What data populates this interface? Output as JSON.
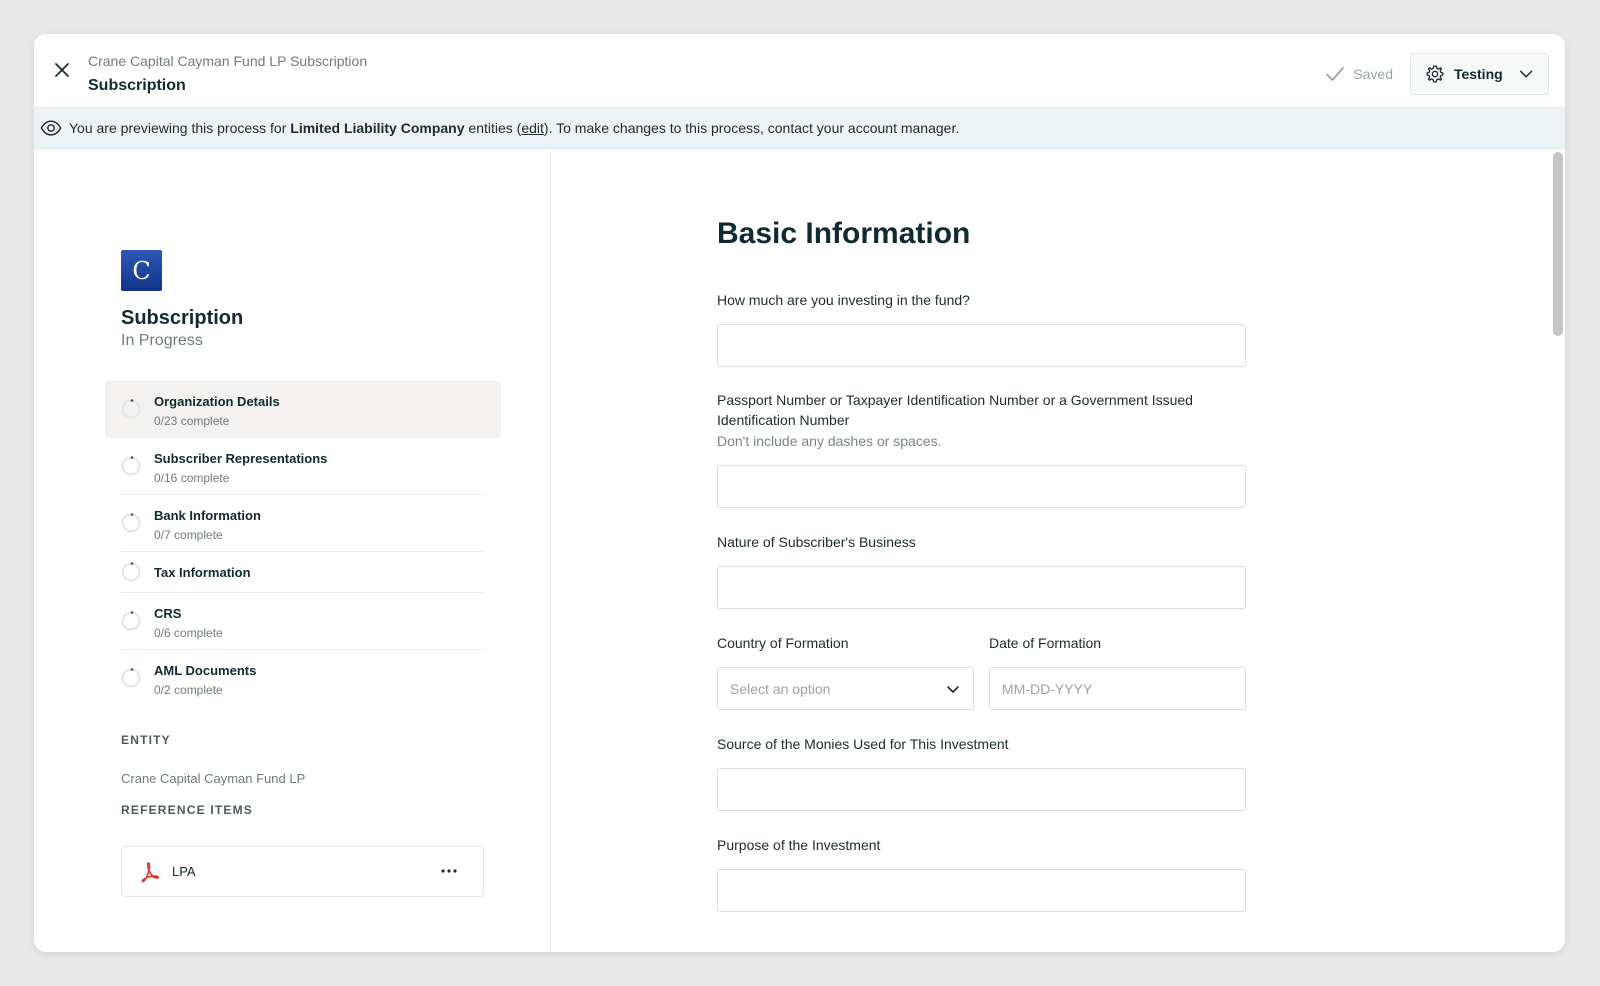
{
  "header": {
    "breadcrumb": "Crane Capital Cayman Fund LP Subscription",
    "title": "Subscription",
    "saved_label": "Saved",
    "env_label": "Testing"
  },
  "banner": {
    "prefix": "You are previewing this process for",
    "entity_type": "Limited Liability Company",
    "mid": "entities (",
    "edit_link": "edit",
    "suffix": "). To make changes to this process, contact your account manager."
  },
  "sidebar": {
    "logo_letter": "C",
    "title": "Subscription",
    "status": "In Progress",
    "steps": [
      {
        "name": "Organization Details",
        "count": "0/23 complete"
      },
      {
        "name": "Subscriber Representations",
        "count": "0/16 complete"
      },
      {
        "name": "Bank Information",
        "count": "0/7 complete"
      },
      {
        "name": "Tax Information",
        "count": ""
      },
      {
        "name": "CRS",
        "count": "0/6 complete"
      },
      {
        "name": "AML Documents",
        "count": "0/2 complete"
      }
    ],
    "entity_label": "ENTITY",
    "entity_value": "Crane Capital Cayman Fund LP",
    "reference_label": "REFERENCE ITEMS",
    "reference_items": [
      {
        "name": "LPA"
      }
    ]
  },
  "form": {
    "title": "Basic Information",
    "fields": {
      "investment_amount": {
        "label": "How much are you investing in the fund?"
      },
      "passport": {
        "label": "Passport Number or Taxpayer Identification Number or a Government Issued Identification Number",
        "help": "Don't include any dashes or spaces."
      },
      "business": {
        "label": "Nature of Subscriber's Business"
      },
      "country": {
        "label": "Country of Formation",
        "placeholder": "Select an option"
      },
      "date": {
        "label": "Date of Formation",
        "placeholder": "MM-DD-YYYY"
      },
      "source": {
        "label": "Source of the Monies Used for This Investment"
      },
      "purpose": {
        "label": "Purpose of the Investment"
      }
    }
  },
  "colors": {
    "accent": "#0f2a30",
    "banner_bg": "#edf2f5",
    "logo": "#1d44a0",
    "pdf_red": "#d9372b"
  }
}
